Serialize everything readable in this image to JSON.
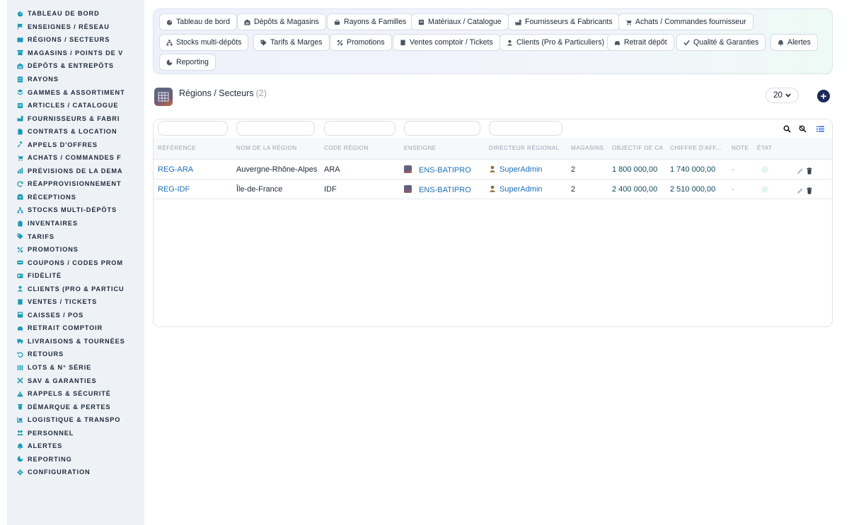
{
  "sidebar": {
    "items": [
      {
        "label": "TABLEAU DE BORD",
        "icon": "gauge-icon"
      },
      {
        "label": "ENSEIGNES / RÉSEAU",
        "icon": "flag-icon"
      },
      {
        "label": "RÉGIONS / SECTEURS",
        "icon": "map-icon"
      },
      {
        "label": "MAGASINS / POINTS DE V",
        "icon": "store-icon"
      },
      {
        "label": "DÉPÔTS & ENTREPÔTS",
        "icon": "warehouse-icon"
      },
      {
        "label": "RAYONS",
        "icon": "shelves-icon"
      },
      {
        "label": "GAMMES & ASSORTIMENT",
        "icon": "layers-icon"
      },
      {
        "label": "ARTICLES / CATALOGUE",
        "icon": "box-icon"
      },
      {
        "label": "FOURNISSEURS & FABRI",
        "icon": "factory-icon"
      },
      {
        "label": "CONTRATS & LOCATION",
        "icon": "file-icon"
      },
      {
        "label": "APPELS D'OFFRES",
        "icon": "gavel-icon"
      },
      {
        "label": "ACHATS / COMMANDES F",
        "icon": "cart-icon"
      },
      {
        "label": "PRÉVISIONS DE LA DEMA",
        "icon": "chart-icon"
      },
      {
        "label": "RÉAPPROVISIONNEMENT",
        "icon": "refresh-icon"
      },
      {
        "label": "RÉCEPTIONS",
        "icon": "inbox-icon"
      },
      {
        "label": "STOCKS MULTI-DÉPÔTS",
        "icon": "sitemap-icon"
      },
      {
        "label": "INVENTAIRES",
        "icon": "clipboard-icon"
      },
      {
        "label": "TARIFS",
        "icon": "tag-icon"
      },
      {
        "label": "PROMOTIONS",
        "icon": "percent-icon"
      },
      {
        "label": "COUPONS / CODES PROM",
        "icon": "ticket-icon"
      },
      {
        "label": "FIDÉLITÉ",
        "icon": "card-icon"
      },
      {
        "label": "CLIENTS (PRO & PARTICU",
        "icon": "user-icon"
      },
      {
        "label": "VENTES / TICKETS",
        "icon": "receipt-icon"
      },
      {
        "label": "CAISSES / POS",
        "icon": "register-icon"
      },
      {
        "label": "RETRAIT COMPTOIR",
        "icon": "car-icon"
      },
      {
        "label": "LIVRAISONS & TOURNÉES",
        "icon": "truck-icon"
      },
      {
        "label": "RETOURS",
        "icon": "undo-icon"
      },
      {
        "label": "LOTS & N° SÉRIE",
        "icon": "barcode-icon"
      },
      {
        "label": "SAV & GARANTIES",
        "icon": "tools-icon"
      },
      {
        "label": "RAPPELS & SÉCURITÉ",
        "icon": "warning-icon"
      },
      {
        "label": "DÉMARQUE & PERTES",
        "icon": "trash-icon"
      },
      {
        "label": "LOGISTIQUE & TRANSPO",
        "icon": "dolly-icon"
      },
      {
        "label": "PERSONNEL",
        "icon": "users-icon"
      },
      {
        "label": "ALERTES",
        "icon": "bell-icon"
      },
      {
        "label": "REPORTING",
        "icon": "pie-icon"
      },
      {
        "label": "CONFIGURATION",
        "icon": "gear-icon"
      }
    ]
  },
  "topnav": {
    "tabs": [
      {
        "label": "Tableau de bord",
        "icon": "gauge-icon"
      },
      {
        "label": "Dépôts & Magasins",
        "icon": "warehouse-icon"
      },
      {
        "label": "Rayons & Familles",
        "icon": "basket-icon"
      },
      {
        "label": "Matériaux / Catalogue",
        "icon": "box-icon"
      },
      {
        "label": "Fournisseurs & Fabricants",
        "icon": "factory-icon"
      },
      {
        "label": "Achats / Commandes fournisseur",
        "icon": "cart-icon"
      },
      {
        "label": "Stocks multi-dépôts",
        "icon": "sitemap-icon"
      },
      {
        "label": "Tarifs & Marges",
        "icon": "tag-icon"
      },
      {
        "label": "Promotions",
        "icon": "percent-icon"
      },
      {
        "label": "Ventes comptoir / Tickets",
        "icon": "receipt-icon"
      },
      {
        "label": "Clients (Pro & Particuliers)",
        "icon": "user-icon"
      },
      {
        "label": "Retrait dépôt",
        "icon": "car-icon"
      },
      {
        "label": "Qualité & Garanties",
        "icon": "check-icon"
      },
      {
        "label": "Alertes",
        "icon": "bell-icon"
      },
      {
        "label": "Reporting",
        "icon": "pie-icon"
      }
    ]
  },
  "page": {
    "title": "Régions / Secteurs",
    "count": "(2)",
    "per_page": "20"
  },
  "table": {
    "headers": [
      "RÉFÉRENCE",
      "NOM DE LA RÉGION",
      "CODE RÉGION",
      "ENSEIGNE",
      "DIRECTEUR RÉGIONAL",
      "MAGASINS",
      "OBJECTIF DE CA",
      "CHIFFRE D'AFF...",
      "NOTE",
      "ÉTAT"
    ],
    "rows": [
      {
        "ref": "REG-ARA",
        "name": "Auvergne-Rhône-Alpes",
        "code": "ARA",
        "enseigne": "ENS-BATIPRO",
        "director": "SuperAdmin",
        "stores": "2",
        "objective": "1 800 000,00",
        "revenue": "1 740 000,00",
        "note": "-"
      },
      {
        "ref": "REG-IDF",
        "name": "Île-de-France",
        "code": "IDF",
        "enseigne": "ENS-BATIPRO",
        "director": "SuperAdmin",
        "stores": "2",
        "objective": "2 400 000,00",
        "revenue": "2 510 000,00",
        "note": "-"
      }
    ]
  },
  "colors": {
    "accent": "#1d6fb8",
    "add_button": "#1e2a5a",
    "sidebar_bg": "#eef2f7",
    "icon": "#1a9bb5"
  }
}
